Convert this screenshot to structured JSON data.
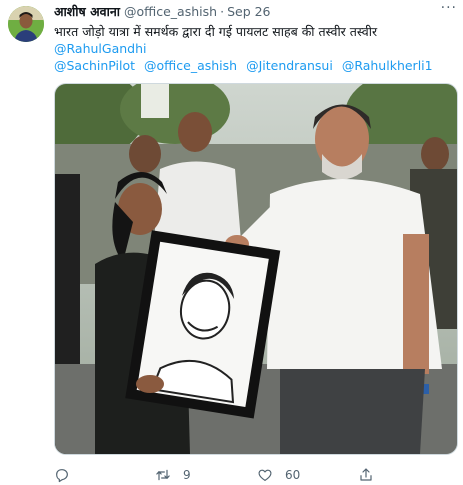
{
  "tweet": {
    "author_name": "आशीष अवाना",
    "handle": "@office_ashish",
    "separator": "·",
    "date": "Sep 26",
    "text": "भारत जोड़ो यात्रा में समर्थक द्वारा दी गई पायलट साहब की तस्वीर तस्वीर",
    "mentions_line1": [
      "@RahulGandhi"
    ],
    "mentions_line2": [
      "@SachinPilot",
      "@office_ashish",
      "@Jitendransui",
      "@Rahulkherli1"
    ],
    "more_label": "···"
  },
  "actions": {
    "reply_count": "",
    "retweet_count": "9",
    "like_count": "60",
    "reply_icon": "reply-icon",
    "retweet_icon": "retweet-icon",
    "like_icon": "heart-icon",
    "share_icon": "share-icon"
  },
  "colors": {
    "link": "#1d9bf0",
    "secondary_text": "#536471",
    "primary_text": "#0f1419",
    "border": "#cfd9de"
  }
}
